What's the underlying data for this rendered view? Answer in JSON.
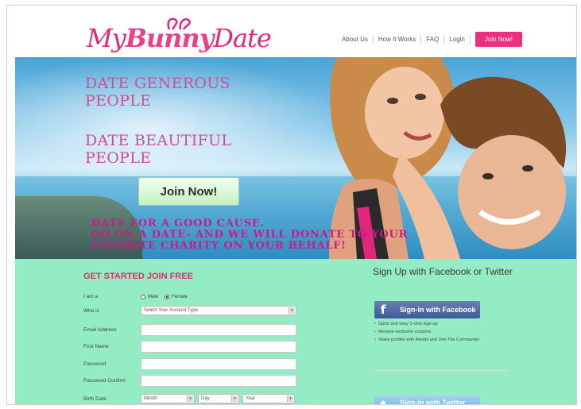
{
  "brand": {
    "name_prefix": "My",
    "name_middle": "Bunny",
    "name_suffix": "Date"
  },
  "nav": {
    "items": [
      "About Us",
      "How It Works",
      "FAQ",
      "Login"
    ],
    "join_label": "Join Now!"
  },
  "hero": {
    "headline_1": "DATE GENEROUS PEOPLE",
    "headline_2": "DATE BEAUTIFUL PEOPLE",
    "join_label": "Join Now!",
    "charity_line_1": "DATE FOR A GOOD CAUSE.",
    "charity_line_2": "GO ON A DATE- AND WE WILL DONATE TO YOUR",
    "charity_line_3": "FAVORITE CHARITY ON YOUR BEHALF!"
  },
  "form": {
    "title": "GET STARTED JOIN FREE",
    "i_am_label": "I am a",
    "gender_options": [
      "Male",
      "Female"
    ],
    "gender_selected": "Female",
    "who_is_label": "Who is",
    "account_type_value": "Select Your Account Type",
    "email_label": "Email Address",
    "first_name_label": "First Name",
    "password_label": "Password",
    "password_confirm_label": "Password Confirm",
    "birth_date_label": "Birth Date",
    "month_value": "Month",
    "day_value": "Day",
    "year_value": "Year"
  },
  "social": {
    "title": "Sign Up with Facebook or Twitter",
    "facebook_label": "Sign-in with Facebook",
    "facebook_bullets": [
      "Quick and easy 1-click sign-up",
      "Receive exclusive coupons",
      "Share profiles with friends and Join The Community!"
    ],
    "twitter_label": "Sign-in with Twitter"
  },
  "colors": {
    "accent": "#e6286f",
    "form_bg": "#93ecc4",
    "facebook": "#3e5a97",
    "twitter": "#68b3e0"
  }
}
